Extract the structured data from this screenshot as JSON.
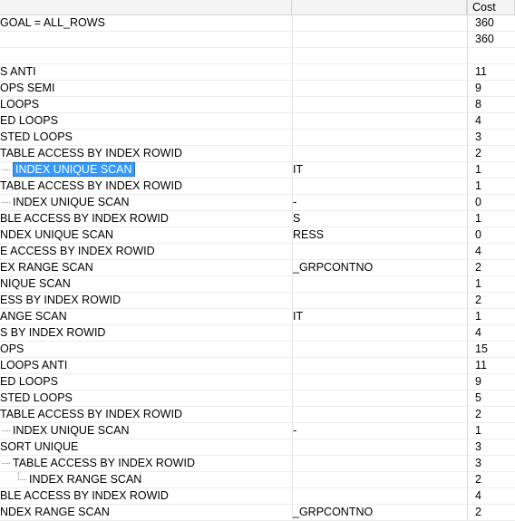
{
  "header": {
    "cost_label": "Cost"
  },
  "rows": [
    {
      "op": "GOAL = ALL_ROWS",
      "indent": 0,
      "obj": "",
      "cost": "360"
    },
    {
      "op": "",
      "indent": 0,
      "obj": "",
      "cost": "360"
    },
    {
      "op": "",
      "indent": 0,
      "obj": "",
      "cost": ""
    },
    {
      "op": "S ANTI",
      "indent": 0,
      "obj": "",
      "cost": "11"
    },
    {
      "op": "OPS SEMI",
      "indent": 0,
      "obj": "",
      "cost": "9"
    },
    {
      "op": " LOOPS",
      "indent": 0,
      "obj": "",
      "cost": "8"
    },
    {
      "op": "ED LOOPS",
      "indent": 0,
      "obj": "",
      "cost": "4"
    },
    {
      "op": "STED LOOPS",
      "indent": 0,
      "obj": "",
      "cost": "3"
    },
    {
      "op": "TABLE ACCESS BY INDEX ROWID",
      "indent": 0,
      "obj": "",
      "cost": "2"
    },
    {
      "op": "INDEX UNIQUE SCAN",
      "indent": 1,
      "obj": "IT",
      "cost": "1",
      "selected": true
    },
    {
      "op": "TABLE ACCESS BY INDEX ROWID",
      "indent": 0,
      "obj": "",
      "cost": "1"
    },
    {
      "op": "INDEX UNIQUE SCAN",
      "indent": 1,
      "obj": "-",
      "cost": "0"
    },
    {
      "op": "BLE ACCESS BY INDEX ROWID",
      "indent": 0,
      "obj": "S",
      "cost": "1"
    },
    {
      "op": "NDEX UNIQUE SCAN",
      "indent": 0,
      "obj": "RESS",
      "cost": "0"
    },
    {
      "op": "E ACCESS BY INDEX ROWID",
      "indent": 0,
      "obj": "",
      "cost": "4"
    },
    {
      "op": "EX RANGE SCAN",
      "indent": 0,
      "obj": "_GRPCONTNO",
      "cost": "2"
    },
    {
      "op": "NIQUE SCAN",
      "indent": 0,
      "obj": "",
      "cost": "1"
    },
    {
      "op": "ESS BY INDEX ROWID",
      "indent": 0,
      "obj": "",
      "cost": "2"
    },
    {
      "op": "ANGE SCAN",
      "indent": 0,
      "obj": "IT",
      "cost": "1"
    },
    {
      "op": "S BY INDEX ROWID",
      "indent": 0,
      "obj": "",
      "cost": "4"
    },
    {
      "op": "OPS",
      "indent": 0,
      "obj": "",
      "cost": "15"
    },
    {
      "op": " LOOPS ANTI",
      "indent": 0,
      "obj": "",
      "cost": "11"
    },
    {
      "op": "ED LOOPS",
      "indent": 0,
      "obj": "",
      "cost": "9"
    },
    {
      "op": "STED LOOPS",
      "indent": 0,
      "obj": "",
      "cost": "5"
    },
    {
      "op": "TABLE ACCESS BY INDEX ROWID",
      "indent": 0,
      "obj": "",
      "cost": "2"
    },
    {
      "op": "INDEX UNIQUE SCAN",
      "indent": 1,
      "obj": "-",
      "cost": "1"
    },
    {
      "op": "SORT UNIQUE",
      "indent": 0,
      "obj": "",
      "cost": "3"
    },
    {
      "op": "TABLE ACCESS BY INDEX ROWID",
      "indent": 1,
      "obj": "",
      "cost": "3"
    },
    {
      "op": "INDEX RANGE SCAN",
      "indent": 2,
      "obj": "",
      "cost": "2"
    },
    {
      "op": "BLE ACCESS BY INDEX ROWID",
      "indent": 0,
      "obj": "",
      "cost": "4"
    },
    {
      "op": "NDEX RANGE SCAN",
      "indent": 0,
      "obj": "_GRPCONTNO",
      "cost": "2"
    }
  ]
}
